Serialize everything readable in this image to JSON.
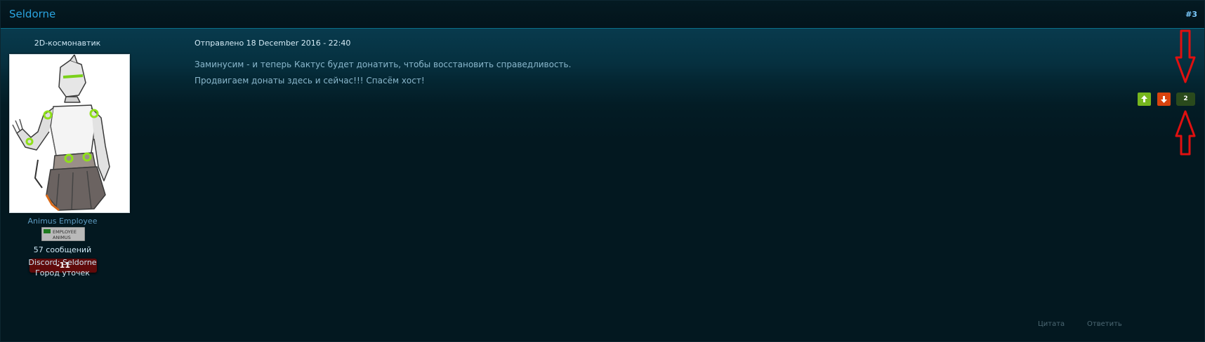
{
  "post": {
    "author_name": "Seldorne",
    "number": "#3",
    "date_label": "Отправлено 18 December 2016 - 22:40",
    "lines": [
      "Заминусим - и теперь Кактус будет донатить, чтобы восстановить справедливость.",
      "Продвигаем донаты здесь и сейчас!!! Спасём хост!"
    ],
    "vote_count": "2",
    "actions": {
      "quote": "Цитата",
      "reply": "Ответить"
    }
  },
  "author": {
    "rank_title": "2D-космонавтик",
    "group_name": "Animus Employee",
    "badge_text": [
      "EMPLOYEE",
      "ANIMUS"
    ],
    "post_count": "57 сообщений",
    "reputation": "-11",
    "discord": "Discord: Seldorne",
    "city": "Город уточек"
  },
  "colors": {
    "accent": "#2aa4e0",
    "vote_up": "#76b61e",
    "vote_down": "#d9430e",
    "reputation_negative": "#600a0a",
    "annotation": "#e01010"
  },
  "icons": {
    "vote_up": "arrow-up-icon",
    "vote_down": "arrow-down-icon",
    "annotation": "red-arrow-icon"
  }
}
